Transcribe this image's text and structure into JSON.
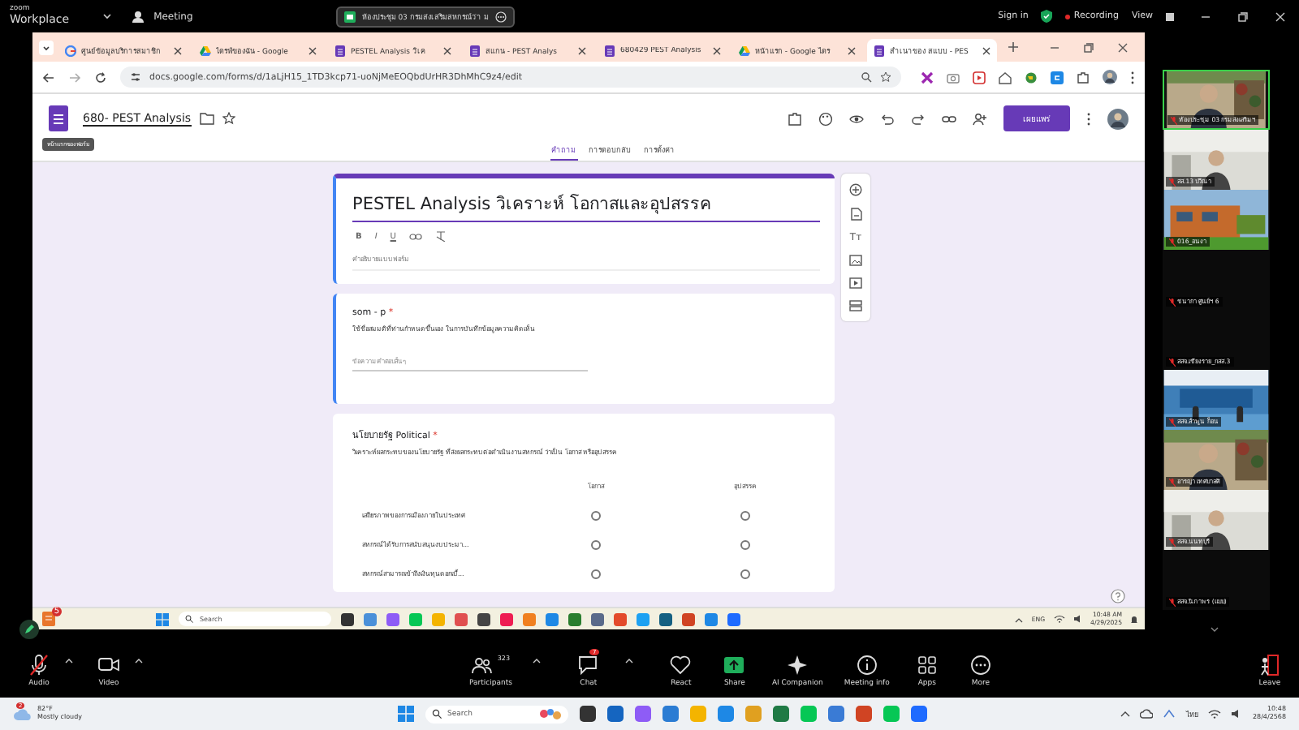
{
  "zoom_top": {
    "brand_top": "zoom",
    "brand": "Workplace",
    "meeting": "Meeting",
    "share_banner": "ห้องประชุม 03 กรมส่งเสริมสหกรณ์ว่า ม",
    "sign_in": "Sign in",
    "recording": "Recording",
    "view": "View"
  },
  "browser": {
    "tabs": [
      {
        "title": "ศูนย์ข้อมูลบริการสมาชิก",
        "kind": "google",
        "selected": false
      },
      {
        "title": "ไดรฟ์ของฉัน - Google",
        "kind": "drive",
        "selected": false
      },
      {
        "title": "PESTEL Analysis วิเค",
        "kind": "forms",
        "selected": false
      },
      {
        "title": "สแกน - PEST Analys",
        "kind": "forms",
        "selected": false
      },
      {
        "title": "680429 PEST Analysis",
        "kind": "forms",
        "selected": false
      },
      {
        "title": "หน้าแรก - Google ไดร",
        "kind": "drive",
        "selected": false
      },
      {
        "title": "สำเนาของ สแบบ - PES",
        "kind": "forms",
        "selected": true
      }
    ],
    "url": "docs.google.com/forms/d/1aLjH15_1TD3kcp71-uoNjMeEOQbdUrHR3DhMhC9z4/edit"
  },
  "form_header": {
    "title": "680- PEST Analysis",
    "tooltip": "หน้าแรกของฟอร์ม",
    "publish": "เผยแพร่",
    "tabs": [
      {
        "label": "คำถาม",
        "selected": true
      },
      {
        "label": "การตอบกลับ",
        "selected": false
      },
      {
        "label": "การตั้งค่า",
        "selected": false
      }
    ]
  },
  "form": {
    "title_card": {
      "title": "PESTEL Analysis วิเคราะห์ โอกาสและอุปสรรค",
      "focused": true,
      "format_buttons": [
        "B",
        "I",
        "U"
      ],
      "description_placeholder": "คำอธิบายแบบฟอร์ม"
    },
    "questions": [
      {
        "kind": "short_answer",
        "title": "som - p",
        "required": true,
        "selected": true,
        "description": "ใช้ชื่อสมมติที่ท่านกำหนดขึ้นเอง ในการบันทึกข้อมูลความคิดเห็น",
        "placeholder": "ข้อความคำตอบสั้นๆ"
      },
      {
        "kind": "grid",
        "title": "นโยบายรัฐ Political",
        "required": true,
        "selected": false,
        "description": "วิเคราะห์ผลกระทบของนโยบายรัฐ ที่ส่งผลกระทบต่อดำเนินงานสหกรณ์ ว่าเป็น โอกาส หรืออุปสรรค",
        "columns": [
          "โอกาส",
          "อุปสรรค"
        ],
        "rows": [
          {
            "label": "เสถียรภาพของการเมืองภายในประเทศ",
            "cells": [
              {
                "checked": false
              },
              {
                "checked": false
              }
            ]
          },
          {
            "label": "สหกรณ์ได้รับการสนับสนุนงบประมา...",
            "cells": [
              {
                "checked": false
              },
              {
                "checked": false
              }
            ]
          },
          {
            "label": "สหกรณ์สามารถเข้าถึงเงินทุนดอกเบี้...",
            "cells": [
              {
                "checked": false
              },
              {
                "checked": false
              }
            ]
          }
        ]
      }
    ],
    "required_mark": "*",
    "side_text_tool": "Tт"
  },
  "inner_taskbar": {
    "notification_badge": "5",
    "search": "Search",
    "language": "ENG",
    "time": "10:48 AM",
    "date": "4/29/2025"
  },
  "participants": [
    {
      "name": "ห้องประชุม 03 กรมส่งเสริมฯ",
      "kind": "video",
      "speaking": true
    },
    {
      "name": "สส.13 ปวีณา",
      "kind": "video",
      "speaking": false
    },
    {
      "name": "016_อนงา",
      "kind": "video",
      "speaking": false
    },
    {
      "name": "ชนากา ศูนย์ฯ 6",
      "kind": "off",
      "speaking": false
    },
    {
      "name": "สสจ.เชียงราย_กสส.3",
      "kind": "off",
      "speaking": false
    },
    {
      "name": "สสจ.ลำพูน ก็อน",
      "kind": "video",
      "speaking": false
    },
    {
      "name": "อารญา เทศบาลศิ",
      "kind": "video",
      "speaking": false
    },
    {
      "name": "สสจ.นนทบุรี",
      "kind": "video",
      "speaking": false
    },
    {
      "name": "สสจ.นิภาพร (แบบ)",
      "kind": "off",
      "speaking": false
    }
  ],
  "meeting_controls": [
    {
      "kind": "audio",
      "label": "Audio",
      "muted": true
    },
    {
      "kind": "video",
      "label": "Video"
    },
    {
      "kind": "participants",
      "label": "Participants",
      "count": "323"
    },
    {
      "kind": "chat",
      "label": "Chat",
      "badge": "7"
    },
    {
      "kind": "react",
      "label": "React"
    },
    {
      "kind": "share",
      "label": "Share"
    },
    {
      "kind": "ai",
      "label": "AI Companion"
    },
    {
      "kind": "info",
      "label": "Meeting info"
    },
    {
      "kind": "apps",
      "label": "Apps"
    },
    {
      "kind": "more",
      "label": "More"
    },
    {
      "kind": "leave",
      "label": "Leave"
    }
  ],
  "taskbar": {
    "weather_badge": "2",
    "temperature": "82°F",
    "weather": "Mostly cloudy",
    "search": "Search",
    "language": "ไทย",
    "time": "10:48",
    "date": "28/4/2568"
  }
}
